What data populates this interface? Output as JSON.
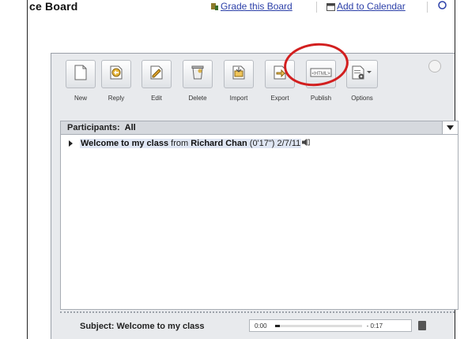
{
  "header": {
    "title": "ce Board",
    "links": [
      {
        "label": "Grade this Board",
        "icon": "grade-icon"
      },
      {
        "label": "Add to Calendar",
        "icon": "calendar-icon"
      }
    ]
  },
  "toolbar": {
    "buttons": [
      {
        "label": "New",
        "icon": "new-document-icon"
      },
      {
        "label": "Reply",
        "icon": "reply-icon"
      },
      {
        "label": "Edit",
        "icon": "edit-icon"
      },
      {
        "label": "Delete",
        "icon": "delete-icon"
      },
      {
        "label": "Import",
        "icon": "import-icon"
      },
      {
        "label": "Export",
        "icon": "export-icon"
      },
      {
        "label": "Publish",
        "icon": "publish-icon"
      },
      {
        "label": "Options",
        "icon": "options-gear-icon"
      }
    ],
    "annotation_color": "#d21f1f"
  },
  "participants": {
    "label": "Participants:",
    "value": "All"
  },
  "thread": {
    "title": "Welcome to my class",
    "from_word": "from",
    "author": "Richard Chan",
    "duration": "(0'17\")",
    "date": "2/7/11"
  },
  "player": {
    "subject_label": "Subject:",
    "subject": "Welcome to my class",
    "time_start": "0:00",
    "time_end": "- 0:17",
    "progress": 0.03
  }
}
